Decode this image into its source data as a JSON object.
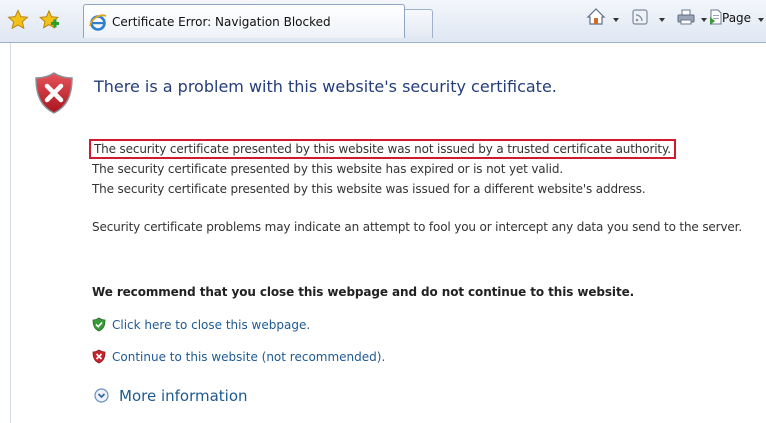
{
  "toolbar": {
    "tab_title": "Certificate Error: Navigation Blocked",
    "page_menu_label": "Page",
    "icons": [
      "favorites-star-icon",
      "add-favorites-icon",
      "ie-icon",
      "home-icon",
      "feeds-icon",
      "print-icon",
      "page-icon"
    ]
  },
  "content": {
    "title": "There is a problem with this website's security certificate.",
    "reasons": [
      "The security certificate presented by this website was not issued by a trusted certificate authority.",
      "The security certificate presented by this website has expired or is not yet valid.",
      "The security certificate presented by this website was issued for a different website's address."
    ],
    "warning": "Security certificate problems may indicate an attempt to fool you or intercept any data you send to the server.",
    "recommendation": "We recommend that you close this webpage and do not continue to this website.",
    "actions": {
      "close": "Click here to close this webpage.",
      "continue": "Continue to this website (not recommended)."
    },
    "more_info": "More information"
  },
  "colors": {
    "highlight_border": "#d21a2e",
    "title": "#243d7a",
    "link": "#1d5a92",
    "shield_red": "#c8232c",
    "shield_green": "#3a9a3a"
  }
}
